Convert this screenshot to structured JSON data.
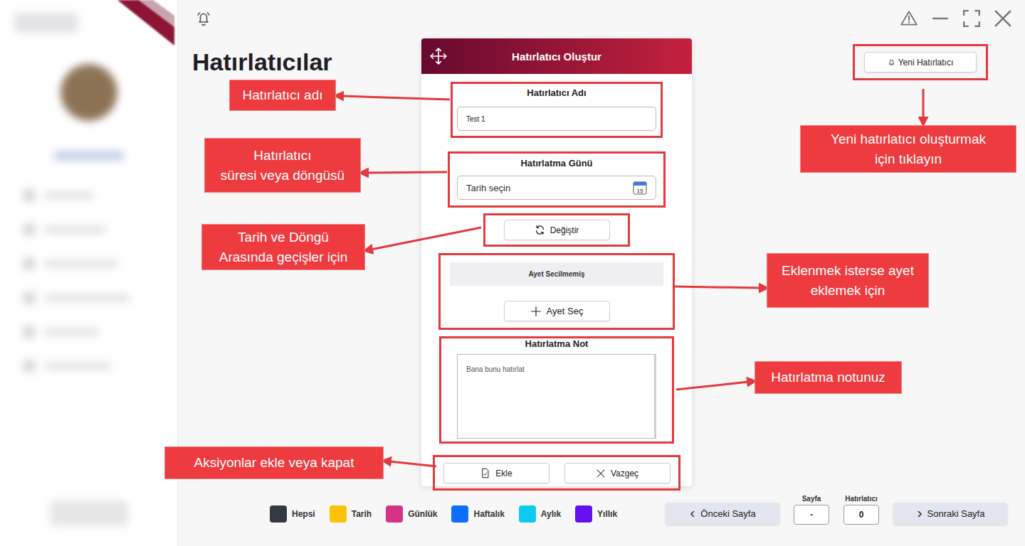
{
  "window": {
    "title": "Hatırlatıcılar"
  },
  "toolbar": {
    "new_button": "Yeni Hatırlatıcı"
  },
  "dialog": {
    "title": "Hatırlatıcı Oluştur",
    "name_field": {
      "label": "Hatırlatıcı Adı",
      "value": "Test 1"
    },
    "date_field": {
      "label": "Hatırlatma Günü",
      "placeholder": "Tarih seçin",
      "calendar_day": "15"
    },
    "toggle_button": "Değiştir",
    "verse": {
      "status": "Ayet Secilmemiş",
      "button": "Ayet Seç"
    },
    "note_field": {
      "label": "Hatırlatma Not",
      "placeholder": "Bana bunu hatırlat"
    },
    "actions": [
      {
        "label": "Ekle",
        "kind": "confirm"
      },
      {
        "label": "Vazgeç",
        "kind": "cancel"
      }
    ]
  },
  "legend": [
    {
      "label": "Hepsi",
      "color": "#343a40"
    },
    {
      "label": "Tarih",
      "color": "#ffc107"
    },
    {
      "label": "Günlük",
      "color": "#d63384"
    },
    {
      "label": "Haftalık",
      "color": "#0d6efd"
    },
    {
      "label": "Aylık",
      "color": "#0dcaf0"
    },
    {
      "label": "Yıllık",
      "color": "#6610f2"
    }
  ],
  "pagination": {
    "previous": "Önceki Sayfa",
    "next": "Sonraki Sayfa",
    "page_label": "Sayfa",
    "page_value": "-",
    "count_label": "Hatırlatıcı",
    "count_value": "0"
  },
  "annotations": [
    {
      "lines": [
        "Hatırlatıcı adı"
      ]
    },
    {
      "lines": [
        "Hatırlatıcı",
        "süresi veya döngüsü"
      ]
    },
    {
      "lines": [
        "Tarih ve Döngü",
        "Arasında geçişler için"
      ]
    },
    {
      "lines": [
        "Eklenmek isterse ayet",
        "eklemek için"
      ]
    },
    {
      "lines": [
        "Hatırlatma notunuz"
      ]
    },
    {
      "lines": [
        "Aksiyonlar ekle veya kapat"
      ]
    },
    {
      "lines": [
        "Yeni hatırlatıcı oluşturmak",
        "için tıklayın"
      ]
    }
  ]
}
